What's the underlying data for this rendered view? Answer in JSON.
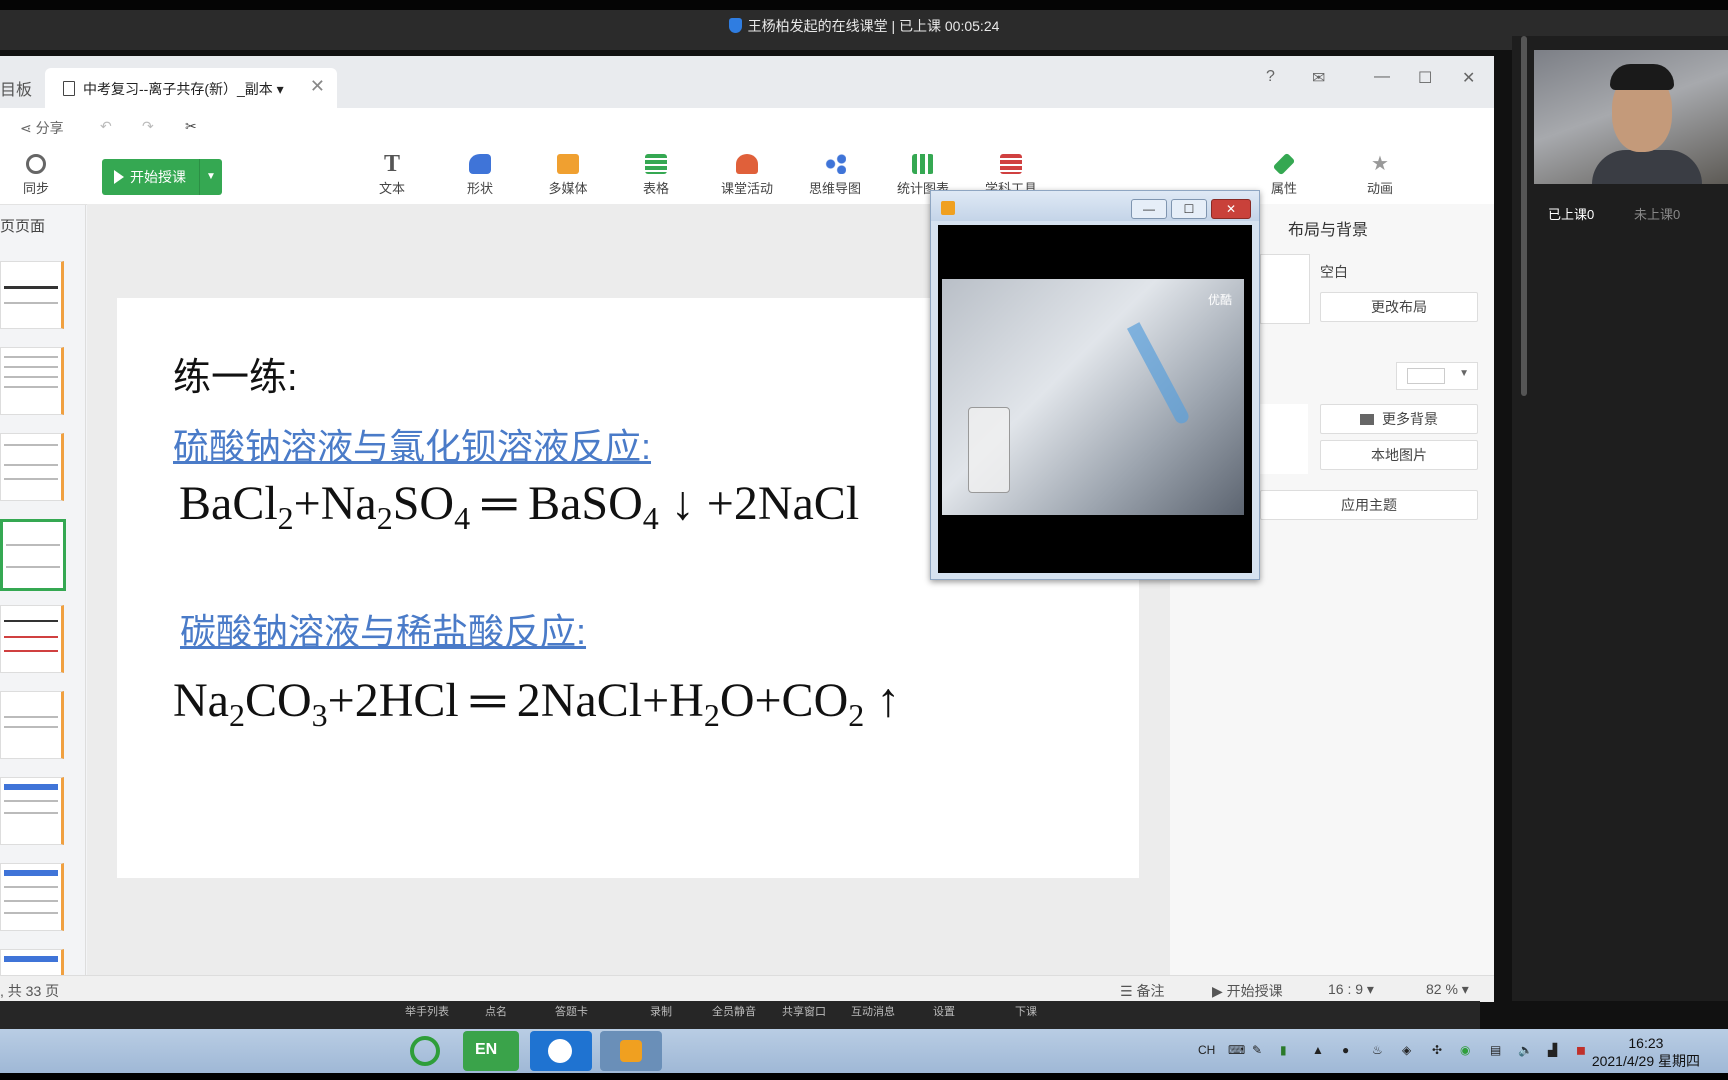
{
  "top_title": "王杨柏发起的在线课堂 | 已上课 00:05:24",
  "app": {
    "tab_left_partial": "目板",
    "doc_tab_label": "中考复习--离子共存(新）_副本",
    "doc_tab_dropdown": "▾",
    "close_glyph": "✕",
    "window_buttons": [
      "?",
      "✉",
      "—",
      "☐",
      "✕"
    ],
    "row1": {
      "share": "分享",
      "undo_icon": "↶",
      "redo_icon": "↷",
      "cut_icon": "✂"
    },
    "sync_label": "同步",
    "start_button": "开始授课",
    "tools": [
      {
        "label": "文本",
        "icon": "text-icon",
        "color": "#555555"
      },
      {
        "label": "形状",
        "icon": "shape-icon",
        "color": "#3f74d8"
      },
      {
        "label": "多媒体",
        "icon": "media-icon",
        "color": "#f0a030"
      },
      {
        "label": "表格",
        "icon": "table-icon",
        "color": "#35a852"
      },
      {
        "label": "课堂活动",
        "icon": "activity-icon",
        "color": "#e0603a"
      },
      {
        "label": "思维导图",
        "icon": "mindmap-icon",
        "color": "#3f74d8"
      },
      {
        "label": "统计图表",
        "icon": "chart-icon",
        "color": "#35a852"
      },
      {
        "label": "学科工具",
        "icon": "subject-tools-icon",
        "color": "#d04040"
      }
    ],
    "attributes_label": "属性",
    "animation_label": "动画",
    "pages_header": "页页面",
    "slide": {
      "heading": "练一练:",
      "link1": "硫酸钠溶液与氯化钡溶液反应:",
      "link2": "碳酸钠溶液与稀盐酸反应:",
      "eq1": {
        "a": "BaCl",
        "a_sub": "2",
        "b": "+Na",
        "b_sub": "2",
        "c": "SO",
        "c_sub": "4",
        "d": " ═ BaSO",
        "d_sub": "4",
        "e": " ↓ +2NaCl"
      },
      "eq2": {
        "a": "Na",
        "a_sub": "2",
        "b": "CO",
        "b_sub": "3",
        "c": "+2HCl ═ 2NaCl+H",
        "c_sub": "2",
        "d": "O+CO",
        "d_sub": "2",
        "e": " ↑"
      }
    },
    "right_panel": {
      "title": "布局与背景",
      "blank": "空白",
      "change_layout": "更改布局",
      "more_bg": "更多背景",
      "local_image": "本地图片",
      "apply_theme": "应用主题"
    },
    "status": {
      "pages": ", 共 33 页",
      "notes": "备注",
      "start": "开始授课",
      "ratio": "16 : 9",
      "zoom": "82 %"
    }
  },
  "bottom_menu": [
    "举手列表",
    "点名",
    "答题卡",
    "录制",
    "全员静音",
    "共享窗口",
    "互动消息",
    "设置",
    "下课"
  ],
  "video_window": {
    "watermark": "优酷"
  },
  "webcam": {
    "attended": "已上课0",
    "not_attended": "未上课0"
  },
  "taskbar": {
    "lang": "CH",
    "time": "16:23",
    "date": "2021/4/29 星期四"
  }
}
